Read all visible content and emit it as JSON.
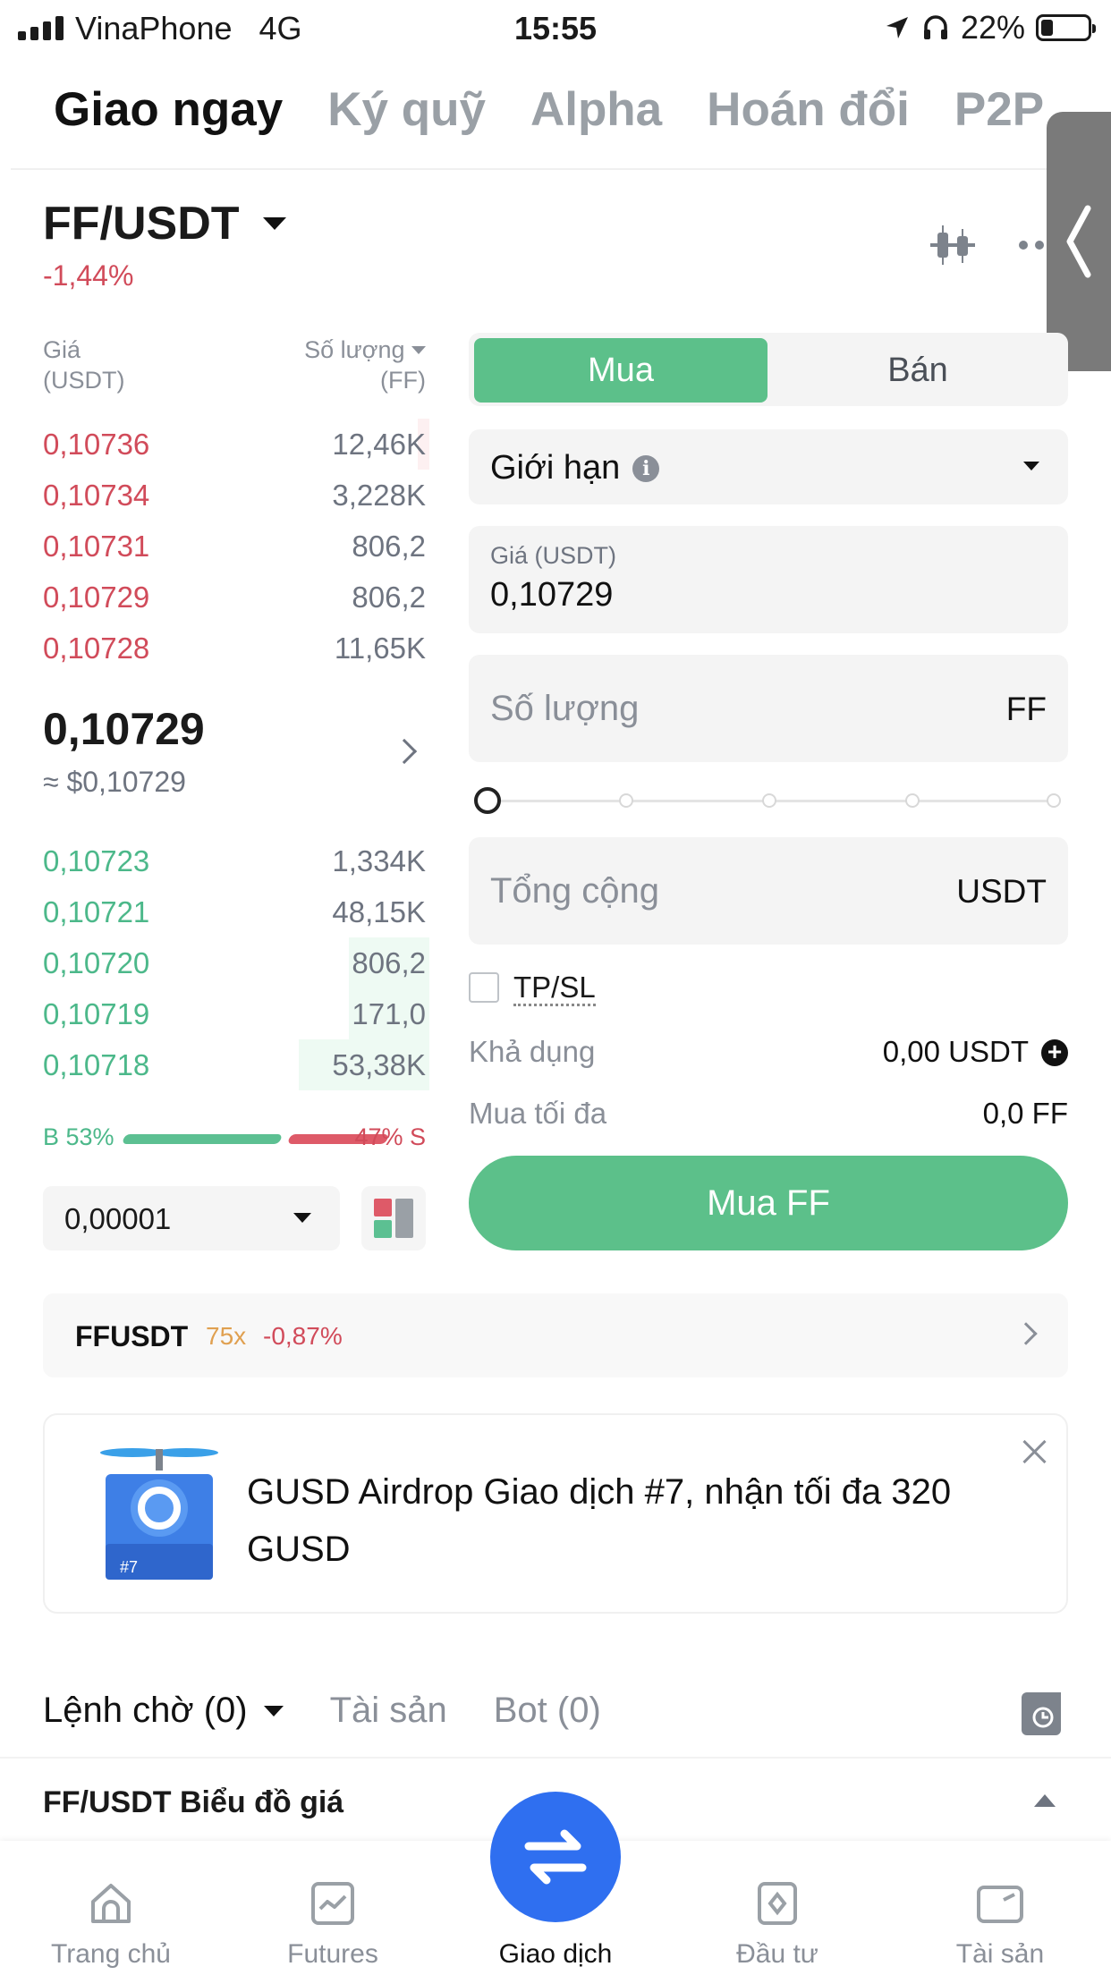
{
  "status_bar": {
    "carrier": "VinaPhone",
    "network": "4G",
    "time": "15:55",
    "battery": "22%"
  },
  "top_tabs": [
    {
      "label": "Giao ngay",
      "active": true
    },
    {
      "label": "Ký quỹ",
      "active": false
    },
    {
      "label": "Alpha",
      "active": false
    },
    {
      "label": "Hoán đổi",
      "active": false
    },
    {
      "label": "P2P",
      "active": false
    }
  ],
  "pair": {
    "symbol": "FF/USDT",
    "change": "-1,44%"
  },
  "order_book": {
    "price_header": "Giá",
    "price_unit": "(USDT)",
    "qty_header": "Số lượng",
    "qty_unit": "(FF)",
    "asks": [
      {
        "price": "0,10736",
        "qty": "12,46K",
        "depth": 0.03
      },
      {
        "price": "0,10734",
        "qty": "3,228K",
        "depth": 0.0
      },
      {
        "price": "0,10731",
        "qty": "806,2",
        "depth": 0.0
      },
      {
        "price": "0,10729",
        "qty": "806,2",
        "depth": 0.0
      },
      {
        "price": "0,10728",
        "qty": "11,65K",
        "depth": 0.0
      }
    ],
    "last_price": "0,10729",
    "last_price_usd": "≈ $0,10729",
    "bids": [
      {
        "price": "0,10723",
        "qty": "1,334K",
        "depth": 0.0
      },
      {
        "price": "0,10721",
        "qty": "48,15K",
        "depth": 0.0
      },
      {
        "price": "0,10720",
        "qty": "806,2",
        "depth": 0.21
      },
      {
        "price": "0,10719",
        "qty": "171,0",
        "depth": 0.21
      },
      {
        "price": "0,10718",
        "qty": "53,38K",
        "depth": 0.34
      }
    ],
    "buy_ratio": "B 53%",
    "sell_ratio": "47% S",
    "tick_size": "0,00001"
  },
  "order_form": {
    "buy_label": "Mua",
    "sell_label": "Bán",
    "order_type": "Giới hạn",
    "price_label": "Giá (USDT)",
    "price_value": "0,10729",
    "qty_placeholder": "Số lượng",
    "qty_unit": "FF",
    "total_placeholder": "Tổng cộng",
    "total_unit": "USDT",
    "slider_percent": 0,
    "tpsl_label": "TP/SL",
    "available_label": "Khả dụng",
    "available_value": "0,00 USDT",
    "max_buy_label": "Mua tối đa",
    "max_buy_value": "0,0 FF",
    "submit_label": "Mua FF"
  },
  "futures_link": {
    "symbol": "FFUSDT",
    "leverage": "75x",
    "change": "-0,87%"
  },
  "promo": {
    "text": "GUSD Airdrop Giao dịch #7, nhận tối đa 320 GUSD",
    "badge": "#7"
  },
  "orders_tabs": [
    {
      "label": "Lệnh chờ (0)",
      "active": true
    },
    {
      "label": "Tài sản",
      "active": false
    },
    {
      "label": "Bot (0)",
      "active": false
    }
  ],
  "chart_strip": {
    "label": "FF/USDT Biểu đồ giá"
  },
  "bottom_nav": [
    {
      "label": "Trang chủ",
      "icon": "home-icon",
      "active": false
    },
    {
      "label": "Futures",
      "icon": "futures-chart-icon",
      "active": false
    },
    {
      "label": "Giao dịch",
      "icon": "swap-icon",
      "active": true
    },
    {
      "label": "Đầu tư",
      "icon": "invest-icon",
      "active": false
    },
    {
      "label": "Tài sản",
      "icon": "wallet-icon",
      "active": false
    }
  ],
  "colors": {
    "buy_green": "#5cc08a",
    "sell_red": "#d14b5a",
    "swap_blue": "#2f6ff0"
  }
}
